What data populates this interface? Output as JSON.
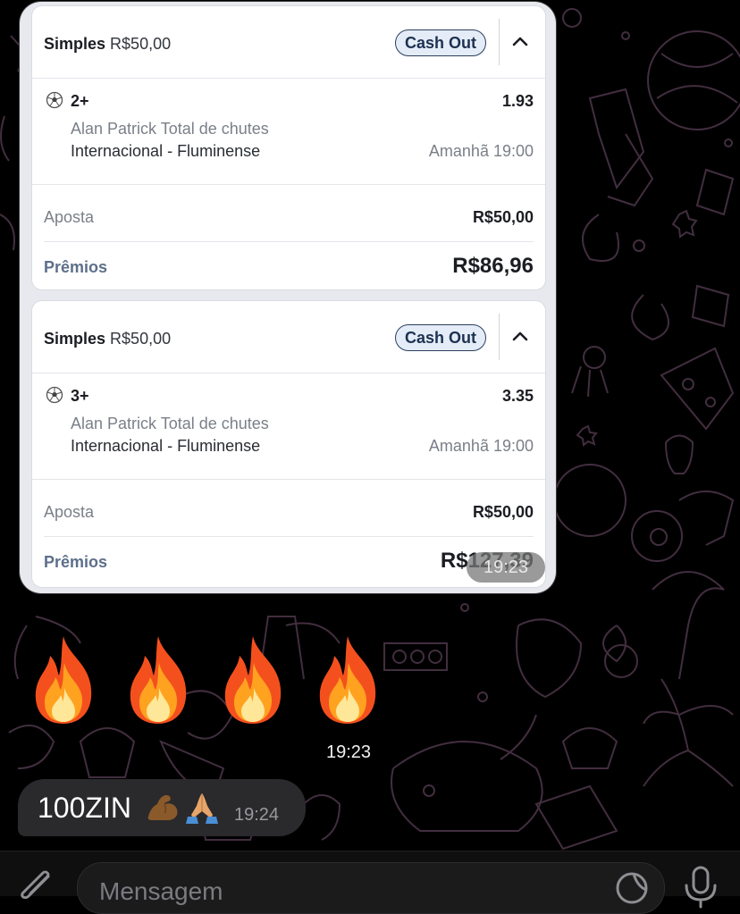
{
  "bet_cards": [
    {
      "bet_type": "Simples",
      "bet_amount": "R$50,00",
      "cashout_label": "Cash Out",
      "selection": "2+",
      "odds": "1.93",
      "market": "Alan Patrick Total de chutes",
      "event": "Internacional - Fluminense",
      "event_time": "Amanhã 19:00",
      "stake_label": "Aposta",
      "stake_value": "R$50,00",
      "prize_label": "Prêmios",
      "prize_value": "R$86,96"
    },
    {
      "bet_type": "Simples",
      "bet_amount": "R$50,00",
      "cashout_label": "Cash Out",
      "selection": "3+",
      "odds": "3.35",
      "market": "Alan Patrick Total de chutes",
      "event": "Internacional - Fluminense",
      "event_time": "Amanhã 19:00",
      "stake_label": "Aposta",
      "stake_value": "R$50,00",
      "prize_label": "Prêmios",
      "prize_value": "R$127,39"
    }
  ],
  "screenshot_message_time": "19:23",
  "flames_message": {
    "emoji": "fire-icon x4",
    "time": "19:23"
  },
  "text_message": {
    "text": "100ZIN",
    "emojis": [
      "flexed-biceps-icon",
      "folded-hands-icon"
    ],
    "time": "19:24"
  },
  "composer": {
    "placeholder": "Mensagem"
  },
  "colors": {
    "accent": "#2b3f5e",
    "prize_label": "#5d6f8a",
    "bubble": "#2a2a2c",
    "wallpaper_line": "#4a3346"
  }
}
